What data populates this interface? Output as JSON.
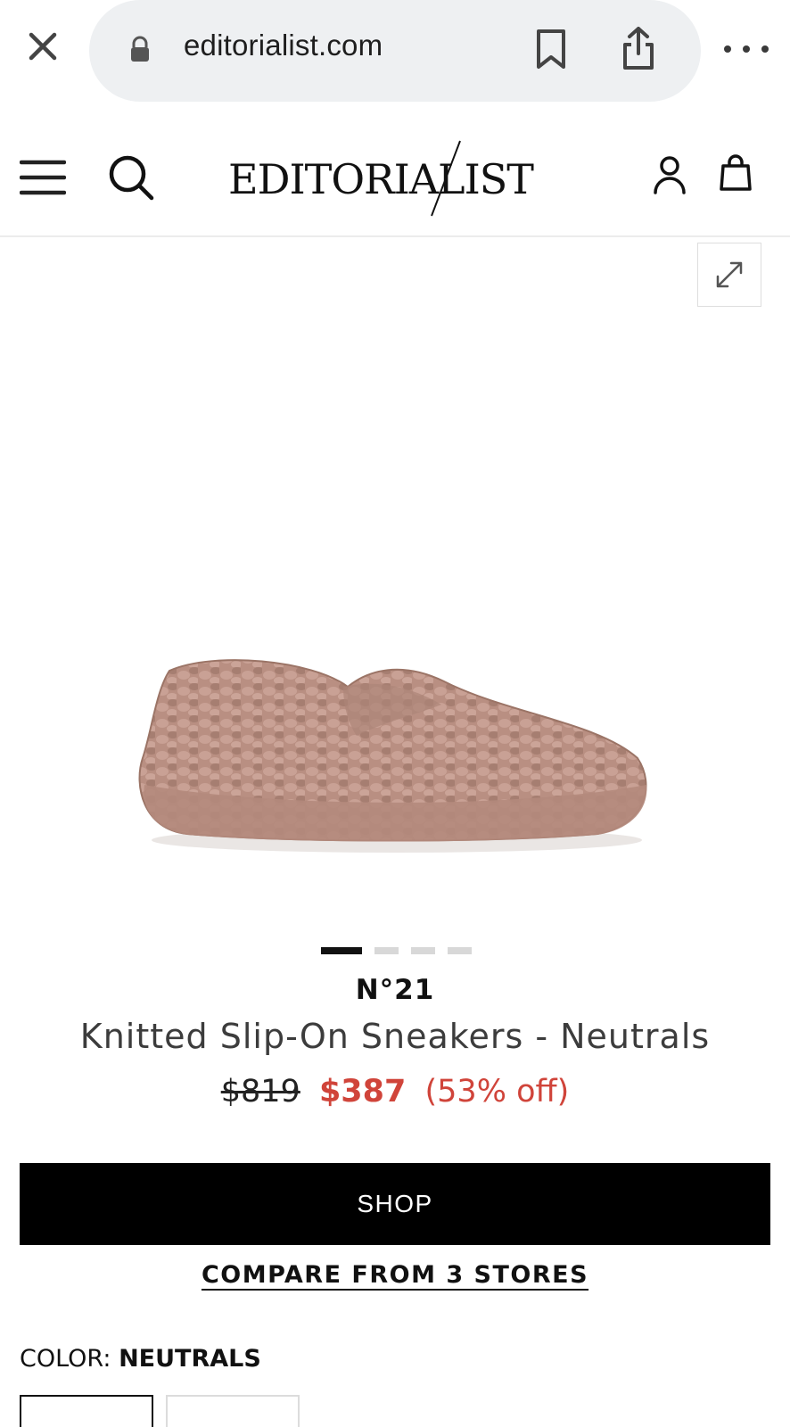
{
  "browser": {
    "url": "editorialist.com",
    "icons": [
      "close-icon",
      "lock-icon",
      "bookmark-icon",
      "share-icon",
      "more-icon"
    ]
  },
  "site": {
    "logo_text": "EDITORIALIST",
    "icons": [
      "menu-icon",
      "search-icon",
      "account-icon",
      "shopping-bag-icon"
    ]
  },
  "gallery": {
    "image_count": 4,
    "active_index": 0,
    "expand_icon": "expand-icon"
  },
  "product": {
    "brand": "N°21",
    "title": "Knitted Slip-On Sneakers - Neutrals",
    "price_original": "$819",
    "price_sale": "$387",
    "discount": "(53% off)"
  },
  "actions": {
    "shop_label": "SHOP",
    "compare_label": "COMPARE FROM 3 STORES"
  },
  "color": {
    "label": "COLOR:",
    "value": "NEUTRALS"
  },
  "colors": {
    "sale": "#d0443a",
    "button": "#000000",
    "urlbar": "#eef0f2"
  }
}
